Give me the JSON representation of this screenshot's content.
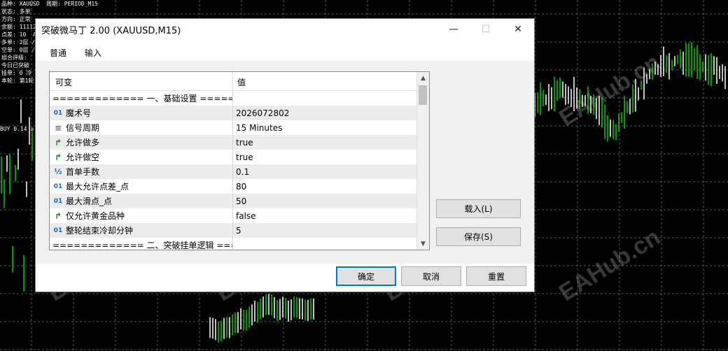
{
  "overlay": {
    "lines": [
      "品种: XAUUSD  周期: PERIOD_M15",
      "状态: 多单",
      "方向: 正常",
      "余额: 11112",
      "点差: 10  A",
      "多单: 2层 /",
      "空单: 0层 /",
      "组合评级: ",
      "今日已突破",
      "挂单: 0 冷",
      "本轮: 第1轮"
    ],
    "buy_label": "BUY 0.14 a"
  },
  "watermark": "EAHub.cn",
  "dialog": {
    "title": "突破微马丁 2.00 (XAUUSD,M15)",
    "minimize_glyph": "—",
    "maximize_glyph": "☐",
    "close_glyph": "✕",
    "tabs": [
      {
        "label": "普通",
        "active": false
      },
      {
        "label": "输入",
        "active": true
      }
    ],
    "grid": {
      "col_name": "可变",
      "col_value": "值",
      "rows": [
        {
          "type": "sep",
          "name": "============= 一、基础设置 ========",
          "value": ""
        },
        {
          "type": "int",
          "icon": "01",
          "name": "魔术号",
          "value": "2026072802"
        },
        {
          "type": "enum",
          "icon": "≡",
          "name": "信号周期",
          "value": "15 Minutes"
        },
        {
          "type": "bool",
          "icon": "↱",
          "name": "允许做多",
          "value": "true"
        },
        {
          "type": "bool",
          "icon": "↱",
          "name": "允许做空",
          "value": "true"
        },
        {
          "type": "double",
          "icon": "½",
          "name": "首单手数",
          "value": "0.1"
        },
        {
          "type": "int",
          "icon": "01",
          "name": "最大允许点差_点",
          "value": "80"
        },
        {
          "type": "int",
          "icon": "01",
          "name": "最大滑点_点",
          "value": "50"
        },
        {
          "type": "bool",
          "icon": "↱",
          "name": "仅允许黄金品种",
          "value": "false"
        },
        {
          "type": "int",
          "icon": "01",
          "name": "整轮结束冷却分钟",
          "value": "5"
        },
        {
          "type": "sep",
          "name": "============= 二、突破挂单逻辑 ====",
          "value": ""
        }
      ]
    },
    "buttons": {
      "load": "载入(L)",
      "save": "保存(S)",
      "ok": "确定",
      "cancel": "取消",
      "reset": "重置"
    }
  }
}
